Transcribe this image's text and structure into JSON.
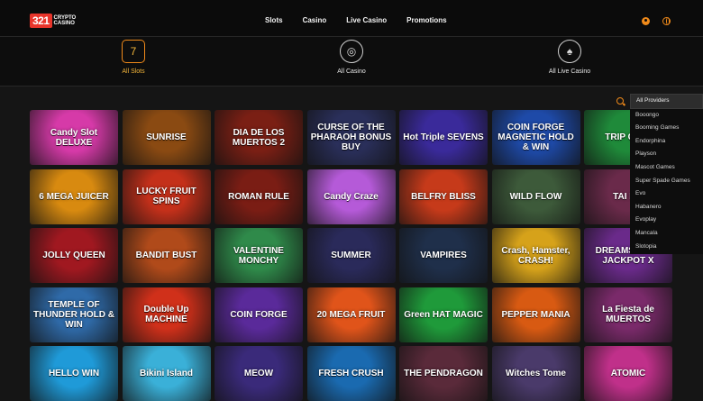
{
  "brand": {
    "number": "321",
    "name": "CRYPTO CASINO"
  },
  "nav": [
    "Slots",
    "Casino",
    "Live Casino",
    "Promotions"
  ],
  "header_icons": [
    "user-icon",
    "globe-icon"
  ],
  "categories": [
    {
      "label": "All Slots",
      "icon": "slot-machine-icon",
      "active": true
    },
    {
      "label": "All Casino",
      "icon": "poker-chip-icon",
      "active": false
    },
    {
      "label": "All Live Casino",
      "icon": "cards-icon",
      "active": false
    }
  ],
  "providers": {
    "selected": "All Providers",
    "options": [
      "All Providers",
      "Booongo",
      "Booming Games",
      "Endorphina",
      "Playson",
      "Mascot Games",
      "Super Spade Games",
      "Evo",
      "Habanero",
      "Evoplay",
      "Mancala",
      "Slotopia"
    ]
  },
  "games": [
    [
      {
        "title": "Candy Slot DELUXE",
        "color": "#d63aa8"
      },
      {
        "title": "SUNRISE",
        "color": "#8a4a12"
      },
      {
        "title": "DIA DE LOS MUERTOS 2",
        "color": "#7a1f14"
      },
      {
        "title": "CURSE OF THE PHARAOH BONUS BUY",
        "color": "#2a2f5a"
      },
      {
        "title": "Hot Triple SEVENS",
        "color": "#3a2a9a"
      },
      {
        "title": "COIN FORGE MAGNETIC HOLD & WIN",
        "color": "#1e4aa8"
      },
      {
        "title": "TRIP CHILI",
        "color": "#1f8a3a"
      }
    ],
    [
      {
        "title": "6 MEGA JUICER",
        "color": "#d88a10"
      },
      {
        "title": "LUCKY FRUIT SPINS",
        "color": "#c4301a"
      },
      {
        "title": "ROMAN RULE",
        "color": "#7a1d14"
      },
      {
        "title": "Candy Craze",
        "color": "#b55ad8"
      },
      {
        "title": "BELFRY BLISS",
        "color": "#c63a1a"
      },
      {
        "title": "WILD FLOW",
        "color": "#3d5a3a"
      },
      {
        "title": "TAI MA",
        "color": "#6a2a4a"
      }
    ],
    [
      {
        "title": "JOLLY QUEEN",
        "color": "#a01820"
      },
      {
        "title": "BANDIT BUST",
        "color": "#b04a1a"
      },
      {
        "title": "VALENTINE MONCHY",
        "color": "#2f8a4a"
      },
      {
        "title": "SUMMER",
        "color": "#2a2a5a"
      },
      {
        "title": "VAMPIRES",
        "color": "#1f2f4a"
      },
      {
        "title": "Crash, Hamster, CRASH!",
        "color": "#d6a21a"
      },
      {
        "title": "DREAMSHOCK JACKPOT X",
        "color": "#6a2a8a"
      }
    ],
    [
      {
        "title": "TEMPLE OF THUNDER HOLD & WIN",
        "color": "#2f6aa8"
      },
      {
        "title": "Double Up MACHINE",
        "color": "#d0301a"
      },
      {
        "title": "COIN FORGE",
        "color": "#5a2a9a"
      },
      {
        "title": "20 MEGA FRUIT",
        "color": "#e0541a"
      },
      {
        "title": "Green HAT MAGIC",
        "color": "#1f9a3a"
      },
      {
        "title": "PEPPER MANIA",
        "color": "#d85a12"
      },
      {
        "title": "La Fiesta de MUERTOS",
        "color": "#7a2a6a"
      }
    ],
    [
      {
        "title": "HELLO WIN",
        "color": "#1f9ad8"
      },
      {
        "title": "Bikini Island",
        "color": "#3ab0d8"
      },
      {
        "title": "MEOW",
        "color": "#3a2a7a"
      },
      {
        "title": "FRESH CRUSH",
        "color": "#1a6ab0"
      },
      {
        "title": "THE PENDRAGON",
        "color": "#5a2a3a"
      },
      {
        "title": "Witches Tome",
        "color": "#4a3a6a"
      },
      {
        "title": "ATOMIC",
        "color": "#c0308a"
      }
    ]
  ]
}
